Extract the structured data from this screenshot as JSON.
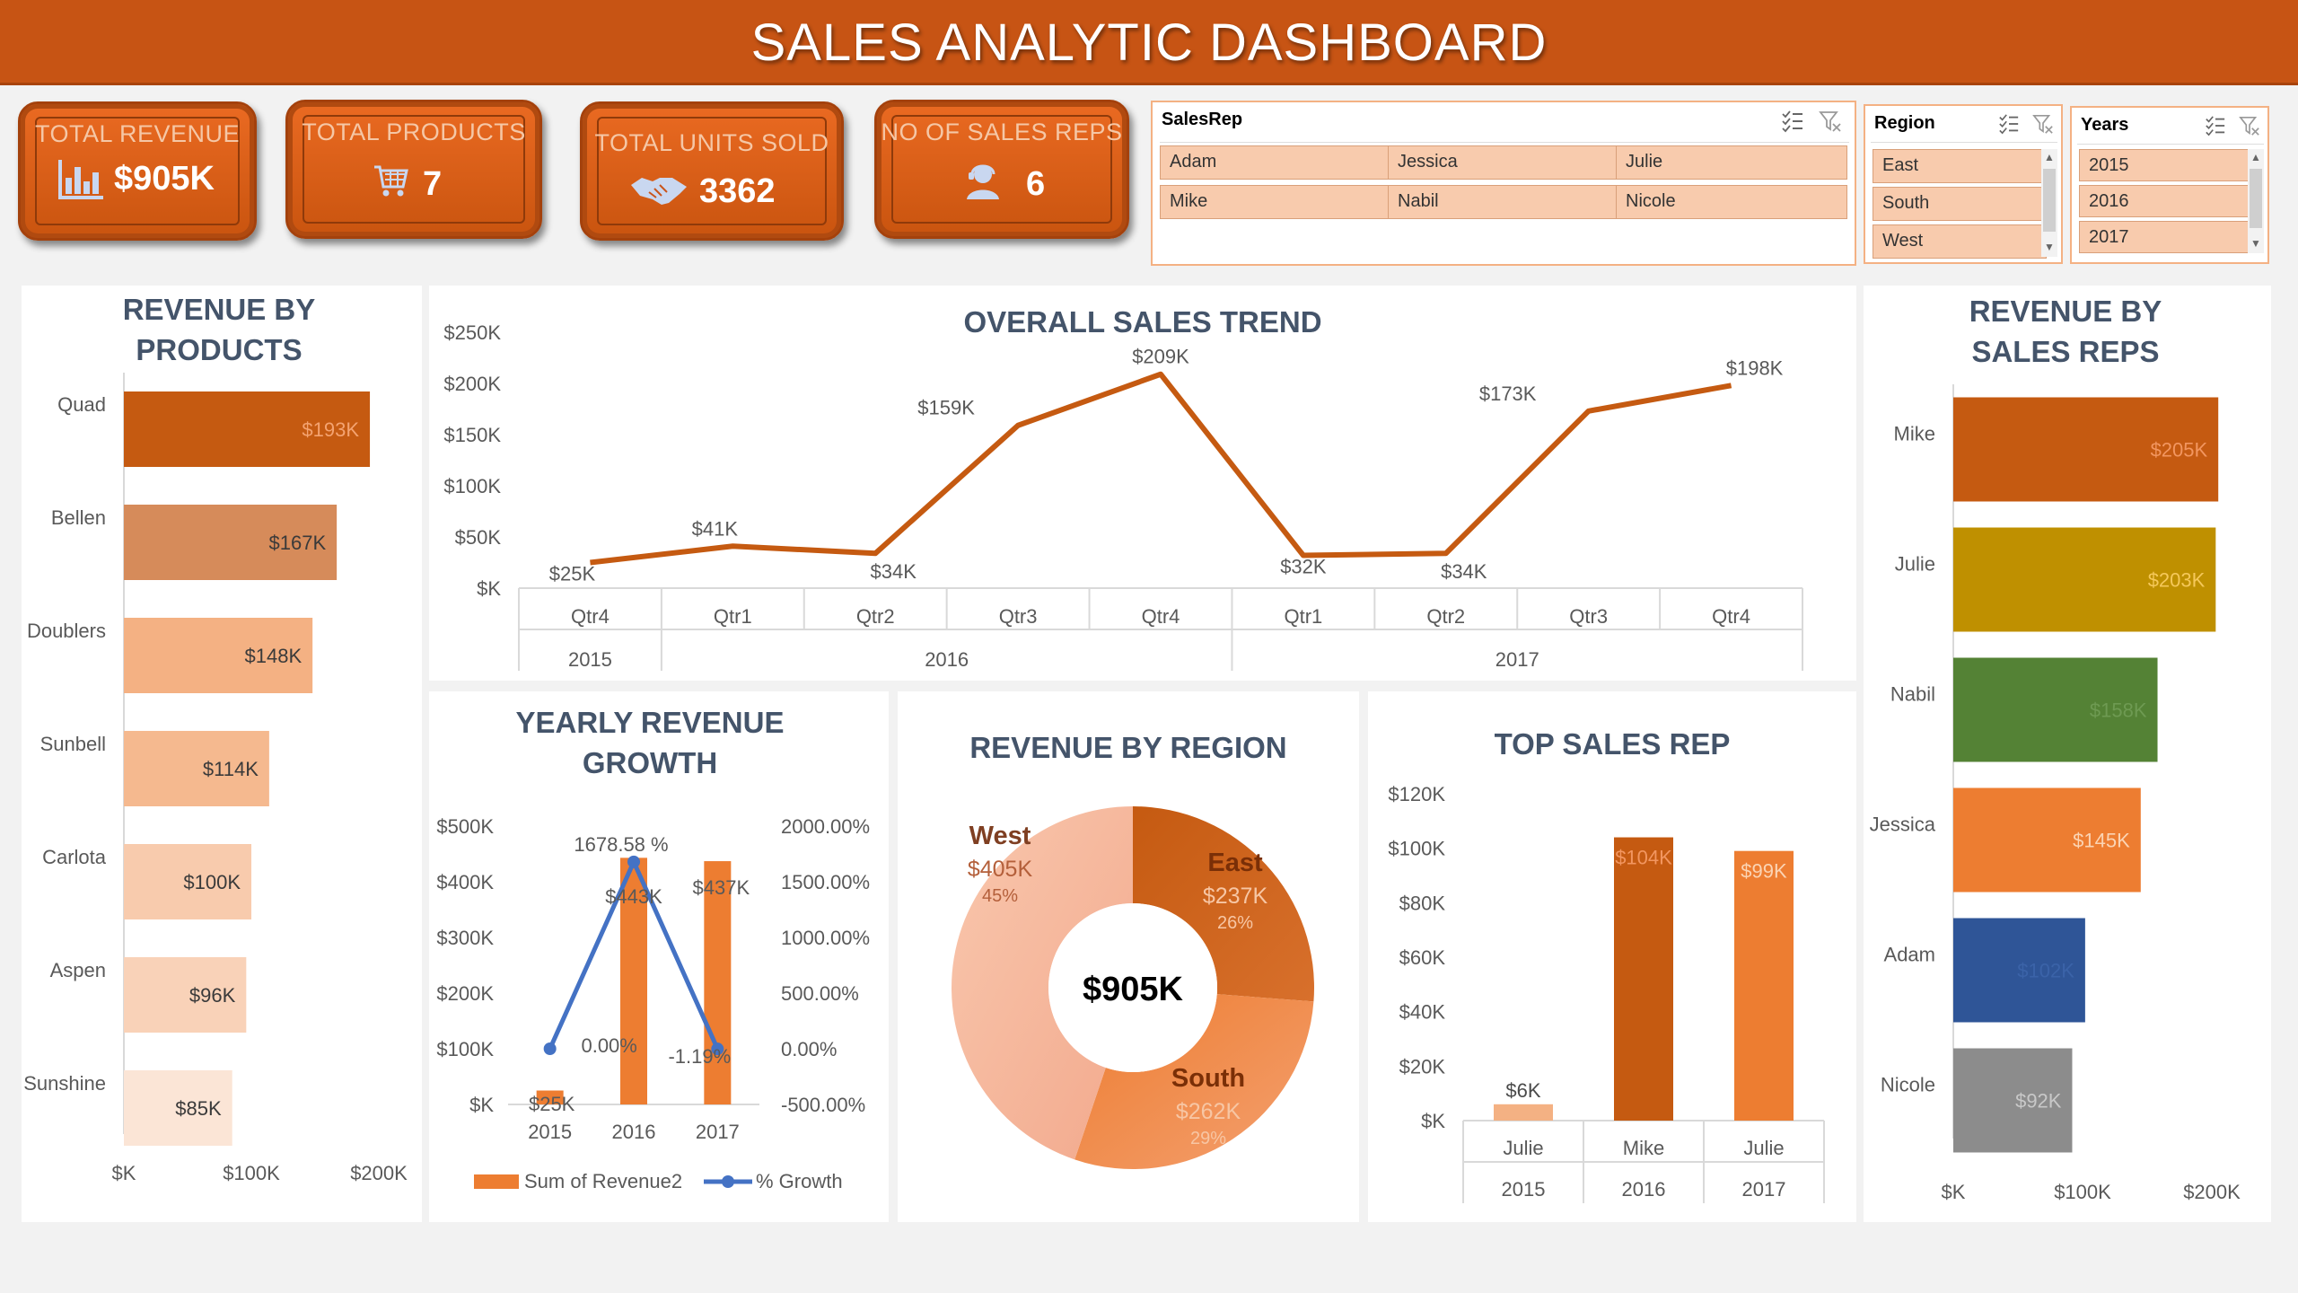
{
  "header": {
    "title": "SALES ANALYTIC DASHBOARD"
  },
  "kpis": {
    "revenue": {
      "label": "TOTAL REVENUE",
      "value": "$905K"
    },
    "products": {
      "label": "TOTAL PRODUCTS",
      "value": "7"
    },
    "units": {
      "label": "TOTAL UNITS SOLD",
      "value": "3362"
    },
    "reps": {
      "label": "NO OF SALES REPS",
      "value": "6"
    }
  },
  "slicers": {
    "salesrep": {
      "title": "SalesRep",
      "items": [
        "Adam",
        "Jessica",
        "Julie",
        "Mike",
        "Nabil",
        "Nicole"
      ]
    },
    "region": {
      "title": "Region",
      "items": [
        "East",
        "South",
        "West"
      ]
    },
    "years": {
      "title": "Years",
      "items": [
        "2015",
        "2016",
        "2017"
      ]
    }
  },
  "colors": {
    "accent": "#c75414",
    "title_text": "#44546a",
    "revenue_line": "#c55a11",
    "growth_line": "#4472c4"
  },
  "chart_data": [
    {
      "id": "revenue-by-products",
      "type": "bar",
      "title": "REVENUE BY PRODUCTS",
      "categories": [
        "Quad",
        "Bellen",
        "Doublers",
        "Sunbell",
        "Carlota",
        "Aspen",
        "Sunshine"
      ],
      "values": [
        193,
        167,
        148,
        114,
        100,
        96,
        85
      ],
      "labels": [
        "$193K",
        "$167K",
        "$148K",
        "$114K",
        "$100K",
        "$96K",
        "$85K"
      ],
      "colors": [
        "#c55a11",
        "#d68b5a",
        "#f4b183",
        "#f5b98f",
        "#f8cbad",
        "#f9d2b8",
        "#fbe5d6"
      ],
      "xticks": [
        "$K",
        "$100K",
        "$200K"
      ],
      "xlim": [
        0,
        200
      ]
    },
    {
      "id": "overall-sales-trend",
      "type": "line",
      "title": "OVERALL SALES TREND",
      "x": [
        "Qtr4",
        "Qtr1",
        "Qtr2",
        "Qtr3",
        "Qtr4",
        "Qtr1",
        "Qtr2",
        "Qtr3",
        "Qtr4"
      ],
      "years": [
        "2015",
        "2016",
        "2017"
      ],
      "values": [
        25,
        41,
        34,
        159,
        209,
        32,
        34,
        173,
        198
      ],
      "labels": [
        "$25K",
        "$41K",
        "$34K",
        "$159K",
        "$209K",
        "$32K",
        "$34K",
        "$173K",
        "$198K"
      ],
      "yticks": [
        "$K",
        "$50K",
        "$100K",
        "$150K",
        "$200K",
        "$250K"
      ],
      "ylim": [
        0,
        250
      ]
    },
    {
      "id": "yearly-revenue-growth",
      "type": "bar",
      "title": "YEARLY REVENUE GROWTH",
      "categories": [
        "2015",
        "2016",
        "2017"
      ],
      "series": [
        {
          "name": "Sum of Revenue2",
          "values": [
            25,
            443,
            437
          ],
          "labels": [
            "$25K",
            "$443K",
            "$437K"
          ]
        },
        {
          "name": "% Growth",
          "values": [
            0.0,
            1678.58,
            -1.19
          ],
          "labels": [
            "0.00%",
            "1678.58 %",
            "-1.19%"
          ]
        }
      ],
      "yticks_left": [
        "$K",
        "$100K",
        "$200K",
        "$300K",
        "$400K",
        "$500K"
      ],
      "yticks_right": [
        "-500.00%",
        "0.00%",
        "500.00%",
        "1000.00%",
        "1500.00%",
        "2000.00%"
      ],
      "ylim_left": [
        0,
        500
      ],
      "ylim_right": [
        -500,
        2000
      ]
    },
    {
      "id": "revenue-by-region",
      "type": "pie",
      "title": "REVENUE BY REGION",
      "center_label": "$905K",
      "slices": [
        {
          "name": "East",
          "value": 237,
          "label": "$237K",
          "pct": "26%",
          "color": "#c55a11"
        },
        {
          "name": "South",
          "value": 262,
          "label": "$262K",
          "pct": "29%",
          "color": "#ed7d31"
        },
        {
          "name": "West",
          "value": 405,
          "label": "$405K",
          "pct": "45%",
          "color": "#f4b6a0"
        }
      ]
    },
    {
      "id": "top-sales-rep",
      "type": "bar",
      "title": "TOP SALES REP",
      "categories": [
        "Julie",
        "Mike",
        "Julie"
      ],
      "years": [
        "2015",
        "2016",
        "2017"
      ],
      "values": [
        6,
        104,
        99
      ],
      "labels": [
        "$6K",
        "$104K",
        "$99K"
      ],
      "colors": [
        "#f4b183",
        "#c55a11",
        "#ed7d31"
      ],
      "yticks": [
        "$K",
        "$20K",
        "$40K",
        "$60K",
        "$80K",
        "$100K",
        "$120K"
      ],
      "ylim": [
        0,
        120
      ]
    },
    {
      "id": "revenue-by-sales-reps",
      "type": "bar",
      "title": "REVENUE BY SALES REPS",
      "categories": [
        "Mike",
        "Julie",
        "Nabil",
        "Jessica",
        "Adam",
        "Nicole"
      ],
      "values": [
        205,
        203,
        158,
        145,
        102,
        92
      ],
      "labels": [
        "$205K",
        "$203K",
        "$158K",
        "$145K",
        "$102K",
        "$92K"
      ],
      "colors": [
        "#c55a11",
        "#bf9000",
        "#548235",
        "#ed7d31",
        "#2f5597",
        "#8c8c8c"
      ],
      "xticks": [
        "$K",
        "$100K",
        "$200K"
      ],
      "xlim": [
        0,
        200
      ]
    }
  ]
}
